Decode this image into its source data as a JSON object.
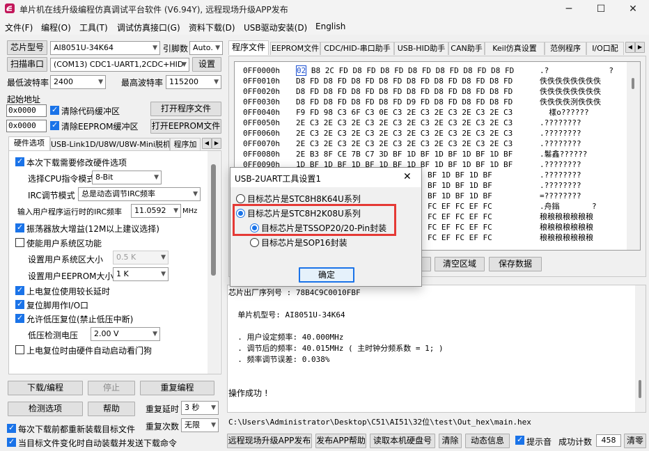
{
  "window": {
    "title": "单片机在线升级编程仿真调试平台软件 (V6.94Y), 远程现场升级APP发布",
    "minimize": "─",
    "maximize": "☐",
    "close": "✕",
    "app_icon": "stc-logo-icon"
  },
  "menu": [
    "文件(F)",
    "编程(O)",
    "工具(T)",
    "调试仿真接口(G)",
    "资料下载(D)",
    "USB驱动安装(D)",
    "English"
  ],
  "left": {
    "chip_type_btn": "芯片型号",
    "chip_type_value": "AI8051U-34K64",
    "pin_count_label": "引脚数",
    "pin_count_value": "Auto.",
    "scan_port_btn": "扫描串口",
    "port_value": "(COM13) CDC1-UART1,2CDC+HID",
    "settings_btn": "设置",
    "min_baud_label": "最低波特率",
    "min_baud_value": "2400",
    "max_baud_label": "最高波特率",
    "max_baud_value": "115200",
    "start_addr_label": "起始地址",
    "addr1": "0x0000",
    "clear_code_buffer": "清除代码缓冲区",
    "open_program_btn": "打开程序文件",
    "addr2": "0x0000",
    "clear_eeprom_buffer": "清除EEPROM缓冲区",
    "open_eeprom_btn": "打开EEPROM文件",
    "tabs": [
      "硬件选项",
      "USB-Link1D/U8W/U8W-Mini脱机",
      "程序加"
    ],
    "hw": {
      "need_modify": "本次下载需要修改硬件选项",
      "cpu_mode_label": "选择CPU指令模式",
      "cpu_mode_value": "8-Bit",
      "irc_mode_label": "IRC调节模式",
      "irc_mode_value": "总是动态调节IRC频率",
      "irc_freq_label": "输入用户程序运行时的IRC频率",
      "irc_freq_value": "11.0592",
      "irc_freq_unit": "MHz",
      "osc_gain": "振荡器放大增益(12M以上建议选择)",
      "user_sys_area": "使能用户系统区功能",
      "user_sys_size_label": "设置用户系统区大小",
      "user_sys_size_value": "0.5 K",
      "user_eeprom_label": "设置用户EEPROM大小",
      "user_eeprom_value": "1   K",
      "power_delay": "上电复位使用较长延时",
      "reset_io": "复位脚用作I/O口",
      "lvr": "允许低压复位(禁止低压中断)",
      "lvd_label": "低压检测电压",
      "lvd_value": "2.00 V",
      "wdt": "上电复位时由硬件自动启动看门狗"
    },
    "download_btn": "下载/编程",
    "stop_btn": "停止",
    "reprogram_btn": "重复编程",
    "check_btn": "检测选项",
    "help_btn": "帮助",
    "repeat_delay_label": "重复延时",
    "repeat_delay_value": "3 秒",
    "repeat_count_label": "重复次数",
    "repeat_count_value": "无限",
    "reload_each": "每次下载前都重新装载目标文件",
    "auto_reload": "当目标文件变化时自动装载并发送下载命令"
  },
  "right": {
    "tabs": [
      "程序文件",
      "EEPROM文件",
      "CDC/HID-串口助手",
      "USB-HID助手",
      "CAN助手",
      "Keil仿真设置",
      "范例程序",
      "I/O口配"
    ],
    "hex_rows": [
      {
        "addr": "0FF0000h",
        "bytes": "02 B8 2C FD D8 FD D8 FD D8 FD D8 FD D8 FD D8 FD",
        "ascii": ".?             ?"
      },
      {
        "addr": "0FF0010h",
        "bytes": "D8 FD D8 FD D8 FD D8 FD D8 FD D8 FD D8 FD D8 FD",
        "ascii": "佚佚佚佚佚佚佚佚"
      },
      {
        "addr": "0FF0020h",
        "bytes": "D8 FD D8 FD D8 FD D8 FD D8 FD D8 FD D8 FD D8 FD",
        "ascii": "佚佚佚佚佚佚佚佚"
      },
      {
        "addr": "0FF0030h",
        "bytes": "D8 FD D8 FD D8 FD D8 FD D9 FD D8 FD D8 FD D8 FD",
        "ascii": "佚佚佚佚洌佚佚佚"
      },
      {
        "addr": "0FF0040h",
        "bytes": "F9 FD 98 C3 6F C3 0E C3 2E C3 2E C3 2E C3 2E C3",
        "ascii": "  樣o?????? "
      },
      {
        "addr": "0FF0050h",
        "bytes": "2E C3 2E C3 2E C3 2E C3 2E C3 2E C3 2E C3 2E C3",
        "ascii": ".????????"
      },
      {
        "addr": "0FF0060h",
        "bytes": "2E C3 2E C3 2E C3 2E C3 2E C3 2E C3 2E C3 2E C3",
        "ascii": ".????????"
      },
      {
        "addr": "0FF0070h",
        "bytes": "2E C3 2E C3 2E C3 2E C3 2E C3 2E C3 2E C3 2E C3",
        "ascii": ".????????"
      },
      {
        "addr": "0FF0080h",
        "bytes": "2E B3 8F CE 7B C7 3D BF 1D BF 1D BF 1D BF 1D BF",
        "ascii": ".鬈鑫??????"
      },
      {
        "addr": "0FF0090h",
        "bytes": "1D BF 1D BF 1D BF 1D BF 1D BF 1D BF 1D BF 1D BF",
        "ascii": ".????????"
      },
      {
        "addr": "",
        "bytes": "BF 1D BF 1D BF",
        "ascii": ".????????"
      },
      {
        "addr": "",
        "bytes": "BF 1D BF 1D BF",
        "ascii": ".????????"
      },
      {
        "addr": "",
        "bytes": "BF 1D BF 1D BF",
        "ascii": "=????????"
      },
      {
        "addr": "",
        "bytes": "FC EF FC EF FC",
        "ascii": ".舟鎓       ?"
      },
      {
        "addr": "",
        "bytes": "FC EF FC EF FC",
        "ascii": "稂稂稂稂稂稂稂"
      },
      {
        "addr": "",
        "bytes": "FC EF FC EF FC",
        "ascii": "稂稂稂稂稂稂稂"
      },
      {
        "addr": "",
        "bytes": "FC EF FC EF FC",
        "ascii": "稂稂稂稂稂稂稂"
      }
    ],
    "clear_area_btn": "清空区域",
    "save_data_btn": "保存数据",
    "log_lines": [
      "芯片出厂序列号 : 78B4C9C0010FBF",
      "",
      "  单片机型号: AI8051U-34K64",
      "",
      "  . 用户设定频率: 40.000MHz",
      "  . 调节后的频率: 40.015MHz ( 主时钟分频系数 = 1; )",
      "  . 频率调节误差: 0.038%",
      "",
      "",
      "操作成功 !"
    ],
    "file_path": "C:\\Users\\Administrator\\Desktop\\C51\\AI51\\32位\\test\\Out_hex\\main.hex",
    "bottom_buttons": [
      "远程现场升级APP发布",
      "发布APP帮助",
      "读取本机硬盘号",
      "清除",
      "动态信息"
    ],
    "beep_label": "提示音",
    "success_count_label": "成功计数",
    "success_count_value": "458",
    "clear_count_btn": "清零"
  },
  "dialog": {
    "title": "USB-2UART工具设置1",
    "close": "✕",
    "options": [
      "目标芯片是STC8H8K64U系列",
      "目标芯片是STC8H2K08U系列",
      "目标芯片是TSSOP20/20-Pin封装",
      "目标芯片是SOP16封装"
    ],
    "ok": "确定",
    "highlight_color": "#e53935"
  }
}
